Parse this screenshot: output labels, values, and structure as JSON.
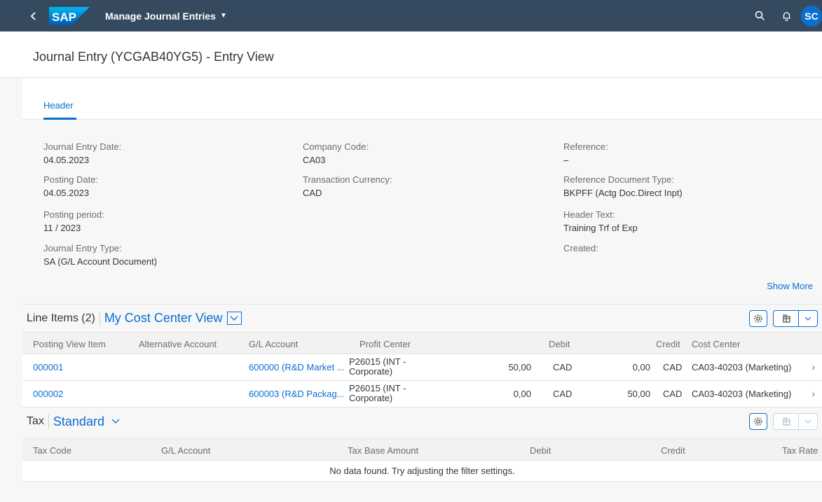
{
  "shell": {
    "app_title": "Manage Journal Entries",
    "logo_text": "SAP",
    "avatar_initials": "SC",
    "colors": {
      "shell_bg": "#354a5f",
      "accent": "#0a6ed1"
    }
  },
  "page": {
    "title": "Journal Entry (YCGAB40YG5) - Entry View"
  },
  "tabs": [
    {
      "label": "Header"
    }
  ],
  "header_fields": {
    "col1": [
      {
        "label": "Journal Entry Date:",
        "value": "04.05.2023"
      },
      {
        "label": "Posting Date:",
        "value": "04.05.2023"
      },
      {
        "label": "Posting period:",
        "value": "11 / 2023"
      },
      {
        "label": "Journal Entry Type:",
        "value": "SA (G/L Account Document)"
      }
    ],
    "col2": [
      {
        "label": "Company Code:",
        "value": "CA03"
      },
      {
        "label": "Transaction Currency:",
        "value": "CAD"
      }
    ],
    "col3": [
      {
        "label": "Reference:",
        "value": "–"
      },
      {
        "label": "Reference Document Type:",
        "value": "BKPFF (Actg Doc.Direct Inpt)"
      },
      {
        "label": "Header Text:",
        "value": "Training Trf of Exp"
      },
      {
        "label": "Created:",
        "value": ""
      }
    ],
    "show_more": "Show More"
  },
  "line_items": {
    "title": "Line Items (2)",
    "variant": "My Cost Center View",
    "columns": {
      "posting_view_item": "Posting View Item",
      "alternative_account": "Alternative Account",
      "gl_account": "G/L Account",
      "profit_center": "Profit Center",
      "debit": "Debit",
      "credit": "Credit",
      "cost_center": "Cost Center"
    },
    "rows": [
      {
        "posting_view_item": "000001",
        "alternative_account": "",
        "gl_account": "600000 (R&D Market ...",
        "profit_center": "P26015 (INT - Corporate)",
        "debit": "50,00",
        "debit_cur": "CAD",
        "credit": "0,00",
        "credit_cur": "CAD",
        "cost_center": "CA03-40203 (Marketing)"
      },
      {
        "posting_view_item": "000002",
        "alternative_account": "",
        "gl_account": "600003 (R&D Packag...",
        "profit_center": "P26015 (INT - Corporate)",
        "debit": "0,00",
        "debit_cur": "CAD",
        "credit": "50,00",
        "credit_cur": "CAD",
        "cost_center": "CA03-40203 (Marketing)"
      }
    ]
  },
  "tax": {
    "title": "Tax",
    "variant": "Standard",
    "columns": {
      "tax_code": "Tax Code",
      "gl_account": "G/L Account",
      "tax_base_amount": "Tax Base Amount",
      "debit": "Debit",
      "credit": "Credit",
      "tax_rate": "Tax Rate"
    },
    "no_data": "No data found. Try adjusting the filter settings."
  },
  "icons": {
    "back": "back-arrow-icon",
    "search": "search-icon",
    "notifications": "bell-icon",
    "settings": "gear-icon",
    "export": "export-spreadsheet-icon",
    "nav": "chevron-right-icon"
  }
}
